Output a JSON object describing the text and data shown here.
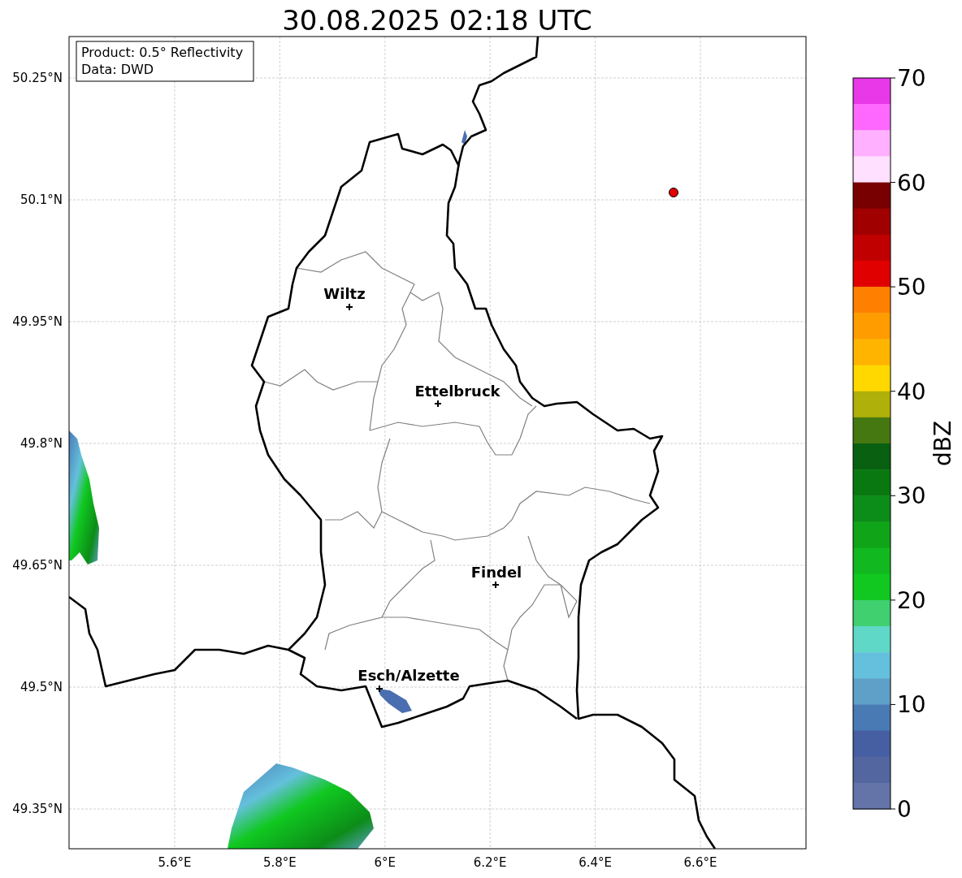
{
  "title": "30.08.2025 02:18 UTC",
  "info_box": [
    "Product: 0.5° Reflectivity",
    "Data: DWD"
  ],
  "lat_ticks": [
    "50.25°N",
    "50.1°N",
    "49.95°N",
    "49.8°N",
    "49.65°N",
    "49.5°N",
    "49.35°N"
  ],
  "lon_ticks": [
    "5.6°E",
    "5.8°E",
    "6°E",
    "6.2°E",
    "6.4°E",
    "6.6°E"
  ],
  "cities": [
    {
      "name": "Wiltz"
    },
    {
      "name": "Ettelbruck"
    },
    {
      "name": "Findel"
    },
    {
      "name": "Esch/Alzette"
    }
  ],
  "colorbar": {
    "label": "dBZ",
    "ticks": [
      "70",
      "60",
      "50",
      "40",
      "30",
      "20",
      "10",
      "0"
    ],
    "bands": [
      {
        "color": "#e838e8"
      },
      {
        "color": "#ff68ff"
      },
      {
        "color": "#ffb0ff"
      },
      {
        "color": "#ffe0ff"
      },
      {
        "color": "#780000"
      },
      {
        "color": "#a00000"
      },
      {
        "color": "#c00000"
      },
      {
        "color": "#e00000"
      },
      {
        "color": "#ff8000"
      },
      {
        "color": "#ff9c00"
      },
      {
        "color": "#ffb400"
      },
      {
        "color": "#ffd800"
      },
      {
        "color": "#b0b00a"
      },
      {
        "color": "#467812"
      },
      {
        "color": "#086010"
      },
      {
        "color": "#0a7810"
      },
      {
        "color": "#0c8c18"
      },
      {
        "color": "#10a418"
      },
      {
        "color": "#12b820"
      },
      {
        "color": "#10c820"
      },
      {
        "color": "#40d070"
      },
      {
        "color": "#60d8c8"
      },
      {
        "color": "#64c0dc"
      },
      {
        "color": "#5ea0c8"
      },
      {
        "color": "#4a7ab4"
      },
      {
        "color": "#455fa2"
      },
      {
        "color": "#5466a0"
      },
      {
        "color": "#6574a8"
      }
    ]
  }
}
